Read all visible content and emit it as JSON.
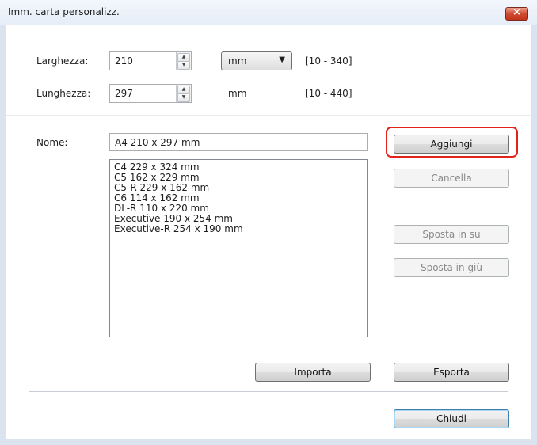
{
  "window": {
    "title": "Imm. carta personalizz.",
    "close_label": "×"
  },
  "width_row": {
    "label": "Larghezza:",
    "value": "210",
    "unit_selected": "mm",
    "unit_options": [
      "mm"
    ],
    "range": "[10 - 340]"
  },
  "length_row": {
    "label": "Lunghezza:",
    "value": "297",
    "unit": "mm",
    "range": "[10 - 440]"
  },
  "name_row": {
    "label": "Nome:",
    "value": "A4 210 x 297 mm"
  },
  "paper_list": {
    "items": [
      "C4 229 x 324 mm",
      "C5 162 x 229 mm",
      "C5-R 229 x 162 mm",
      "C6 114 x 162 mm",
      "DL-R 110 x 220 mm",
      "Executive 190 x 254 mm",
      "Executive-R 254 x 190 mm"
    ]
  },
  "buttons": {
    "add": "Aggiungi",
    "delete": "Cancella",
    "move_up": "Sposta in su",
    "move_down": "Sposta in giù",
    "import": "Importa",
    "export": "Esporta",
    "close": "Chiudi"
  },
  "icons": {
    "spin_up": "spin-up-arrow-icon",
    "spin_down": "spin-down-arrow-icon",
    "dropdown": "chevron-down-icon",
    "close": "close-icon"
  },
  "colors": {
    "highlight": "#e2231a",
    "close_button": "#c13519",
    "default_button_border": "#3c7fb1"
  }
}
